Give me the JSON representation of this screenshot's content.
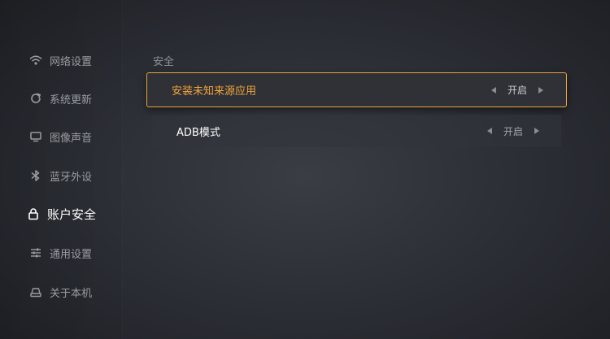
{
  "sidebar": {
    "items": [
      {
        "label": "网络设置",
        "icon": "wifi-icon"
      },
      {
        "label": "系统更新",
        "icon": "refresh-icon"
      },
      {
        "label": "图像声音",
        "icon": "monitor-icon"
      },
      {
        "label": "蓝牙外设",
        "icon": "bluetooth-icon"
      },
      {
        "label": "账户安全",
        "icon": "lock-icon",
        "active": true
      },
      {
        "label": "通用设置",
        "icon": "sliders-icon"
      },
      {
        "label": "关于本机",
        "icon": "device-icon"
      }
    ]
  },
  "main": {
    "section_title": "安全",
    "rows": [
      {
        "label": "安装未知来源应用",
        "value": "开启",
        "focused": true
      },
      {
        "label": "ADB模式",
        "value": "开启",
        "focused": false
      }
    ]
  },
  "colors": {
    "accent": "#e8a43a",
    "accent_text": "#f2a53a",
    "background": "#2d3037"
  }
}
